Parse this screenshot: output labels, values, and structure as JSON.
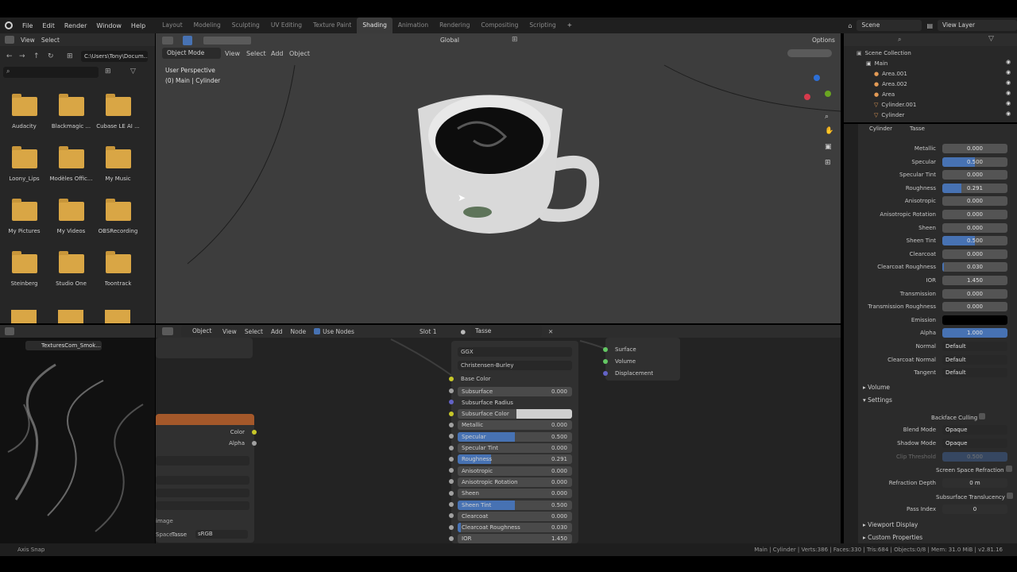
{
  "topbar": {
    "menu": [
      "File",
      "Edit",
      "Render",
      "Window",
      "Help"
    ],
    "workspaces": [
      "Layout",
      "Modeling",
      "Sculpting",
      "UV Editing",
      "Texture Paint",
      "Shading",
      "Animation",
      "Rendering",
      "Compositing",
      "Scripting"
    ],
    "active_workspace": "Shading",
    "scene": "Scene",
    "view_layer": "View Layer"
  },
  "filebrowser": {
    "menu": [
      "View",
      "Select"
    ],
    "path": "C:\\Users\\Tony\\Docum...",
    "folders": [
      "Audacity",
      "Blackmagic ...",
      "Cubase LE AI ...",
      "Loony_Lips",
      "Modèles Offic...",
      "My Music",
      "My Pictures",
      "My Videos",
      "OBSRecording",
      "Steinberg",
      "Studio One",
      "Toontrack"
    ]
  },
  "viewport": {
    "mode": "Object Mode",
    "menu": [
      "View",
      "Select",
      "Add",
      "Object"
    ],
    "transform": "Global",
    "options": "Options",
    "info_line1": "User Perspective",
    "info_line2": "(0) Main | Cylinder"
  },
  "outliner": {
    "title": "Scene Collection",
    "items": [
      "Main",
      "Area.001",
      "Area.002",
      "Area",
      "Cylinder.001",
      "Cylinder"
    ]
  },
  "properties": {
    "breadcrumb_obj": "Cylinder",
    "breadcrumb_mat": "Tasse",
    "rows": [
      {
        "label": "Metallic",
        "value": "0.000",
        "fill": 0
      },
      {
        "label": "Specular",
        "value": "0.500",
        "fill": 0.5
      },
      {
        "label": "Specular Tint",
        "value": "0.000",
        "fill": 0
      },
      {
        "label": "Roughness",
        "value": "0.291",
        "fill": 0.291
      },
      {
        "label": "Anisotropic",
        "value": "0.000",
        "fill": 0
      },
      {
        "label": "Anisotropic Rotation",
        "value": "0.000",
        "fill": 0
      },
      {
        "label": "Sheen",
        "value": "0.000",
        "fill": 0
      },
      {
        "label": "Sheen Tint",
        "value": "0.500",
        "fill": 0.5
      },
      {
        "label": "Clearcoat",
        "value": "0.000",
        "fill": 0
      },
      {
        "label": "Clearcoat Roughness",
        "value": "0.030",
        "fill": 0.03
      },
      {
        "label": "IOR",
        "value": "1.450",
        "fill": 0
      },
      {
        "label": "Transmission",
        "value": "0.000",
        "fill": 0
      },
      {
        "label": "Transmission Roughness",
        "value": "0.000",
        "fill": 0
      }
    ],
    "emission_label": "Emission",
    "alpha_label": "Alpha",
    "alpha_value": "1.000",
    "normal_rows": [
      {
        "label": "Normal",
        "value": "Default"
      },
      {
        "label": "Clearcoat Normal",
        "value": "Default"
      },
      {
        "label": "Tangent",
        "value": "Default"
      }
    ],
    "volume_panel": "Volume",
    "settings_panel": "Settings",
    "backface_culling": "Backface Culling",
    "blend_mode_label": "Blend Mode",
    "blend_mode": "Opaque",
    "shadow_mode_label": "Shadow Mode",
    "shadow_mode": "Opaque",
    "clip_threshold_label": "Clip Threshold",
    "clip_threshold": "0.500",
    "ssr_label": "Screen Space Refraction",
    "refraction_depth_label": "Refraction Depth",
    "refraction_depth": "0 m",
    "sss_label": "Subsurface Translucency",
    "pass_index_label": "Pass Index",
    "pass_index": "0",
    "viewport_display": "Viewport Display",
    "custom_props": "Custom Properties"
  },
  "nodeeditor": {
    "editor_type": "Object",
    "menu": [
      "View",
      "Select",
      "Add",
      "Node"
    ],
    "use_nodes": "Use Nodes",
    "slot": "Slot 1",
    "material": "Tasse",
    "bsdf": {
      "distribution": "GGX",
      "sss_method": "Christensen-Burley",
      "base_color": "Base Color",
      "rows": [
        {
          "label": "Subsurface",
          "value": "0.000",
          "fill": 0
        },
        {
          "label": "Subsurface Radius",
          "value": "",
          "fill": 0
        },
        {
          "label": "Subsurface Color",
          "value": "",
          "fill": 0
        },
        {
          "label": "Metallic",
          "value": "0.000",
          "fill": 0
        },
        {
          "label": "Specular",
          "value": "0.500",
          "fill": 0.5
        },
        {
          "label": "Specular Tint",
          "value": "0.000",
          "fill": 0
        },
        {
          "label": "Roughness",
          "value": "0.291",
          "fill": 0.291
        },
        {
          "label": "Anisotropic",
          "value": "0.000",
          "fill": 0
        },
        {
          "label": "Anisotropic Rotation",
          "value": "0.000",
          "fill": 0
        },
        {
          "label": "Sheen",
          "value": "0.000",
          "fill": 0
        },
        {
          "label": "Sheen Tint",
          "value": "0.500",
          "fill": 0.5
        },
        {
          "label": "Clearcoat",
          "value": "0.000",
          "fill": 0
        },
        {
          "label": "Clearcoat Roughness",
          "value": "0.030",
          "fill": 0.03
        },
        {
          "label": "IOR",
          "value": "1.450",
          "fill": 0
        }
      ]
    },
    "output": {
      "surface": "Surface",
      "volume": "Volume",
      "displacement": "Displacement"
    },
    "texnode": {
      "color": "Color",
      "alpha": "Alpha",
      "image_label": "image",
      "space_label": "Space",
      "space_value": "sRGB",
      "tasse": "Tasse"
    }
  },
  "imgeditor": {
    "image_name": "TexturesCom_Smok..."
  },
  "status": {
    "left": "Axis Snap",
    "right": "Main | Cylinder | Verts:386 | Faces:330 | Tris:684 | Objects:0/8 | Mem: 31.0 MiB | v2.81.16"
  },
  "colors": {
    "accent": "#4772b3",
    "folder": "#d9a645",
    "active_tab": "#3b3b3b"
  }
}
